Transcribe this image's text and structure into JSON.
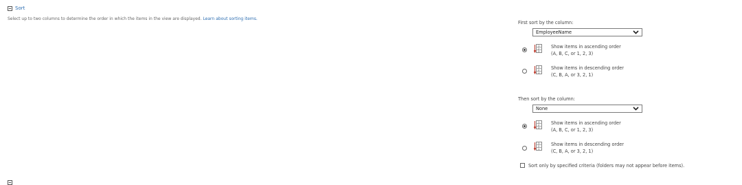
{
  "sort_section": {
    "title": "Sort",
    "description": "Select up to two columns to determine the order in which the items in the view are displayed.",
    "learn_more_link": "Learn about sorting items."
  },
  "first_sort": {
    "label": "First sort by the column:",
    "selected_column": "EmployeeName",
    "ascending": {
      "line1": "Show items in ascending order",
      "line2": "(A, B, C, or 1, 2, 3)",
      "selected": true
    },
    "descending": {
      "line1": "Show items in descending order",
      "line2": "(C, B, A, or 3, 2, 1)",
      "selected": false
    }
  },
  "second_sort": {
    "label": "Then sort by the column:",
    "selected_column": "None",
    "ascending": {
      "line1": "Show items in ascending order",
      "line2": "(A, B, C, or 1, 2, 3)",
      "selected": true
    },
    "descending": {
      "line1": "Show items in descending order",
      "line2": "(C, B, A, or 3, 2, 1)",
      "selected": false
    }
  },
  "sort_only_specified": {
    "label": "Sort only by specified criteria (folders may not appear before items).",
    "checked": false
  },
  "icons": {
    "collapse": "collapse-minus-icon",
    "ascending": "sort-ascending-icon",
    "descending": "sort-descending-icon",
    "dropdown": "chevron-down-icon"
  },
  "colors": {
    "link": "#2b6cb0",
    "text": "#444444",
    "accent_red": "#c0392b"
  }
}
